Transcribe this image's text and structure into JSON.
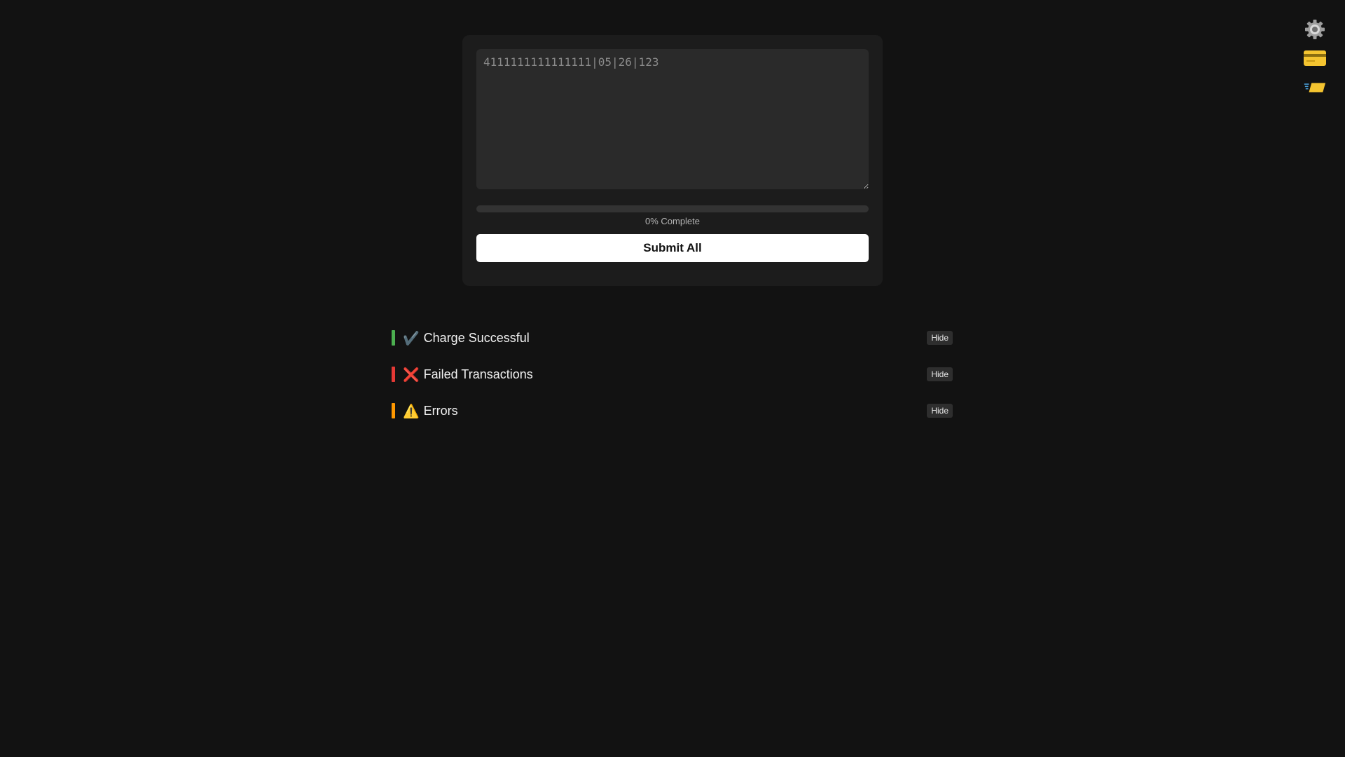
{
  "input": {
    "placeholder": "4111111111111111|05|26|123",
    "value": ""
  },
  "progress": {
    "percent": 0,
    "label": "0% Complete"
  },
  "submit_label": "Submit All",
  "sections": [
    {
      "key": "success",
      "glyph": "✔️",
      "label": "Charge Successful",
      "color": "#4caf50",
      "hide_label": "Hide",
      "icon": "check-icon"
    },
    {
      "key": "failed",
      "glyph": "❌",
      "label": "Failed Transactions",
      "color": "#e53935",
      "hide_label": "Hide",
      "icon": "cross-icon"
    },
    {
      "key": "errors",
      "glyph": "⚠️",
      "label": "Errors",
      "color": "#ff9800",
      "hide_label": "Hide",
      "icon": "warning-icon"
    }
  ],
  "side_icons": [
    "gear-icon",
    "credit-card-icon",
    "fast-card-icon"
  ],
  "colors": {
    "background": "#121212",
    "card": "#1c1c1c",
    "input": "#2a2a2a",
    "success": "#4caf50",
    "failed": "#e53935",
    "errors": "#ff9800",
    "card_icon": "#f4c430"
  }
}
